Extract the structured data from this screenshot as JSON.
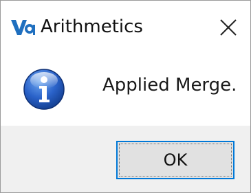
{
  "window": {
    "title": "Arithmetics",
    "icon": "app-logo-icon",
    "close_icon": "close-icon"
  },
  "message": {
    "icon": "info-icon",
    "text": "Applied Merge."
  },
  "buttons": {
    "ok_label": "OK"
  },
  "colors": {
    "accent": "#0078d7",
    "footer_bg": "#f0f0f0",
    "button_bg": "#e1e1e1",
    "info_blue": "#1f5fbf"
  }
}
